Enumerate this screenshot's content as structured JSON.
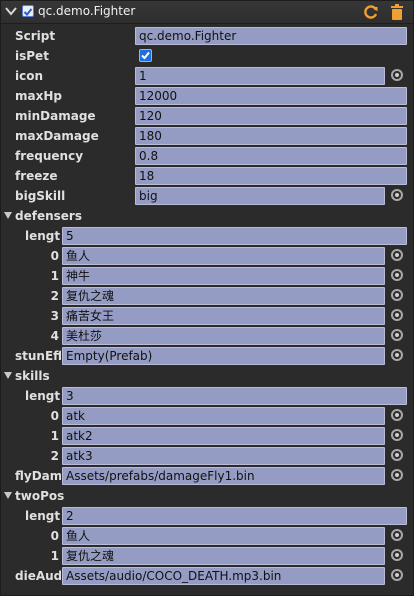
{
  "header": {
    "title": "qc.demo.Fighter"
  },
  "fields": {
    "script_label": "Script",
    "script_value": "qc.demo.Fighter",
    "ispet_label": "isPet",
    "icon_label": "icon",
    "icon_value": "1",
    "maxhp_label": "maxHp",
    "maxhp_value": "12000",
    "mindamage_label": "minDamage",
    "mindamage_value": "120",
    "maxdamage_label": "maxDamage",
    "maxdamage_value": "180",
    "frequency_label": "frequency",
    "frequency_value": "0.8",
    "freeze_label": "freeze",
    "freeze_value": "18",
    "bigskill_label": "bigSkill",
    "bigskill_value": "big"
  },
  "defensers": {
    "label": "defensers",
    "length_label": "length",
    "length_value": "5",
    "items": [
      {
        "index": "0",
        "value": "鱼人"
      },
      {
        "index": "1",
        "value": "神牛"
      },
      {
        "index": "2",
        "value": "复仇之魂"
      },
      {
        "index": "3",
        "value": "痛苦女王"
      },
      {
        "index": "4",
        "value": "美杜莎"
      }
    ]
  },
  "stun": {
    "label": "stunEffe",
    "value": "Empty(Prefab)"
  },
  "skills": {
    "label": "skills",
    "length_label": "length",
    "length_value": "3",
    "items": [
      {
        "index": "0",
        "value": "atk"
      },
      {
        "index": "1",
        "value": "atk2"
      },
      {
        "index": "2",
        "value": "atk3"
      }
    ]
  },
  "flydamage": {
    "label": "flyDama",
    "value": "Assets/prefabs/damageFly1.bin"
  },
  "twopos": {
    "label": "twoPos",
    "length_label": "length",
    "length_value": "2",
    "items": [
      {
        "index": "0",
        "value": "鱼人"
      },
      {
        "index": "1",
        "value": "复仇之魂"
      }
    ]
  },
  "dieaudio": {
    "label": "dieAudi",
    "value": "Assets/audio/COCO_DEATH.mp3.bin"
  },
  "colors": {
    "panel_bg": "#2b2b2b",
    "field_bg": "#959cc3",
    "check_blue": "#1d6fe0"
  }
}
